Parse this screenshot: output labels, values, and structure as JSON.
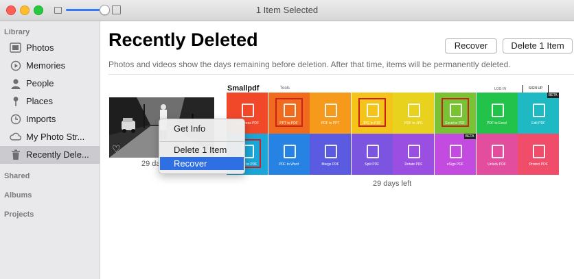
{
  "window": {
    "title": "1 Item Selected",
    "zoom_level": 0.85
  },
  "sidebar": {
    "sections": {
      "library": "Library",
      "shared": "Shared",
      "albums": "Albums",
      "projects": "Projects"
    },
    "items": [
      {
        "label": "Photos",
        "icon": "photos-icon",
        "selected": false
      },
      {
        "label": "Memories",
        "icon": "memories-icon",
        "selected": false
      },
      {
        "label": "People",
        "icon": "person-icon",
        "selected": false
      },
      {
        "label": "Places",
        "icon": "pin-icon",
        "selected": false
      },
      {
        "label": "Imports",
        "icon": "clock-icon",
        "selected": false
      },
      {
        "label": "My Photo Str...",
        "icon": "cloud-icon",
        "selected": false
      },
      {
        "label": "Recently Dele...",
        "icon": "trash-icon",
        "selected": true
      }
    ]
  },
  "main": {
    "title": "Recently Deleted",
    "recover_label": "Recover",
    "delete_label": "Delete 1 Item",
    "subtitle": "Photos and videos show the days remaining before deletion. After that time, items will be permanently deleted.",
    "photos": [
      {
        "days_left": "29 days left",
        "favorite_icon": "heart-icon"
      },
      {
        "days_left": "29 days left"
      }
    ]
  },
  "smallpdf": {
    "logo": "Smallpdf",
    "tools_menu": "Tools",
    "login": "LOG IN",
    "signup": "SIGN UP",
    "beta": "BETA",
    "tiles": [
      {
        "label": "Compress PDF",
        "color": "#f2482a"
      },
      {
        "label": "PPT to PDF",
        "color": "#f06b1e"
      },
      {
        "label": "PDF to PPT",
        "color": "#f59a1b"
      },
      {
        "label": "JPG to PDF",
        "color": "#f5c41a"
      },
      {
        "label": "PDF to JPG",
        "color": "#e8d21e"
      },
      {
        "label": "Excel to PDF",
        "color": "#79c234"
      },
      {
        "label": "PDF to Excel",
        "color": "#23c24a"
      },
      {
        "label": "Edit PDF",
        "color": "#1fb9c4"
      },
      {
        "label": "Word to PDF",
        "color": "#1aa6d6"
      },
      {
        "label": "PDF to Word",
        "color": "#2683e3"
      },
      {
        "label": "Merge PDF",
        "color": "#5a5be0"
      },
      {
        "label": "Split PDF",
        "color": "#7b55e0"
      },
      {
        "label": "Rotate PDF",
        "color": "#9a4fe2"
      },
      {
        "label": "eSign PDF",
        "color": "#c44be0"
      },
      {
        "label": "Unlock PDF",
        "color": "#e24d9e"
      },
      {
        "label": "Protect PDF",
        "color": "#ef4d6a"
      }
    ],
    "highlighted": [
      "PPT to PDF",
      "JPG to PDF",
      "Excel to PDF",
      "Word to PDF"
    ]
  },
  "context_menu": {
    "items": [
      {
        "label": "Get Info",
        "highlighted": false
      },
      {
        "label": "Delete 1 Item",
        "highlighted": false
      },
      {
        "label": "Recover",
        "highlighted": true
      }
    ]
  },
  "colors": {
    "accent": "#2f6fe4",
    "sidebar_bg": "#e9e9ec",
    "sidebar_selected": "#cbcbcf"
  }
}
